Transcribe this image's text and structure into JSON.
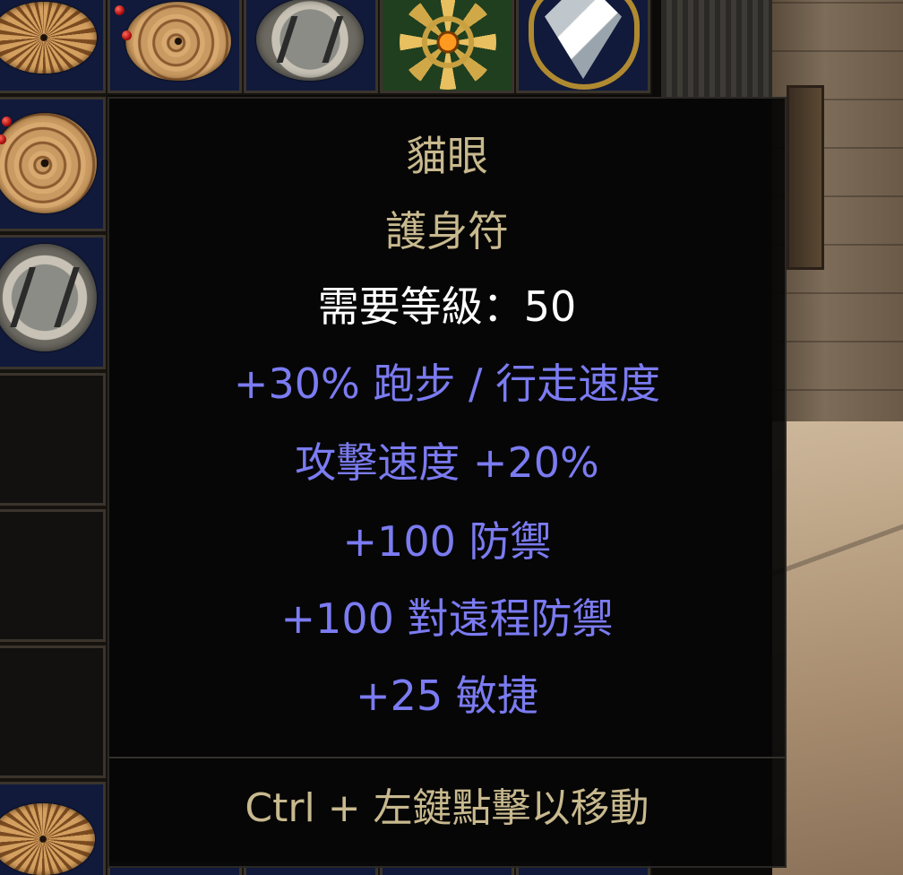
{
  "tooltip": {
    "item_name": "貓眼",
    "item_type": "護身符",
    "requirement": "需要等級：50",
    "stats": [
      "+30% 跑步 / 行走速度",
      "攻擊速度 +20%",
      "+100 防禦",
      "+100 對遠程防禦",
      "+25 敏捷"
    ],
    "hint": "Ctrl + 左鍵點擊以移動"
  },
  "inventory": {
    "visible_items": [
      "lace-charm-icon",
      "swirl-charm-icon",
      "rune-coin-icon",
      "gold-amulet-icon",
      "diamond-jewel-icon"
    ]
  },
  "colors": {
    "unique_gold": "#c8b98e",
    "magic_blue": "#7b7bf2",
    "requirement_white": "#ffffff",
    "tooltip_background": "#060606"
  }
}
